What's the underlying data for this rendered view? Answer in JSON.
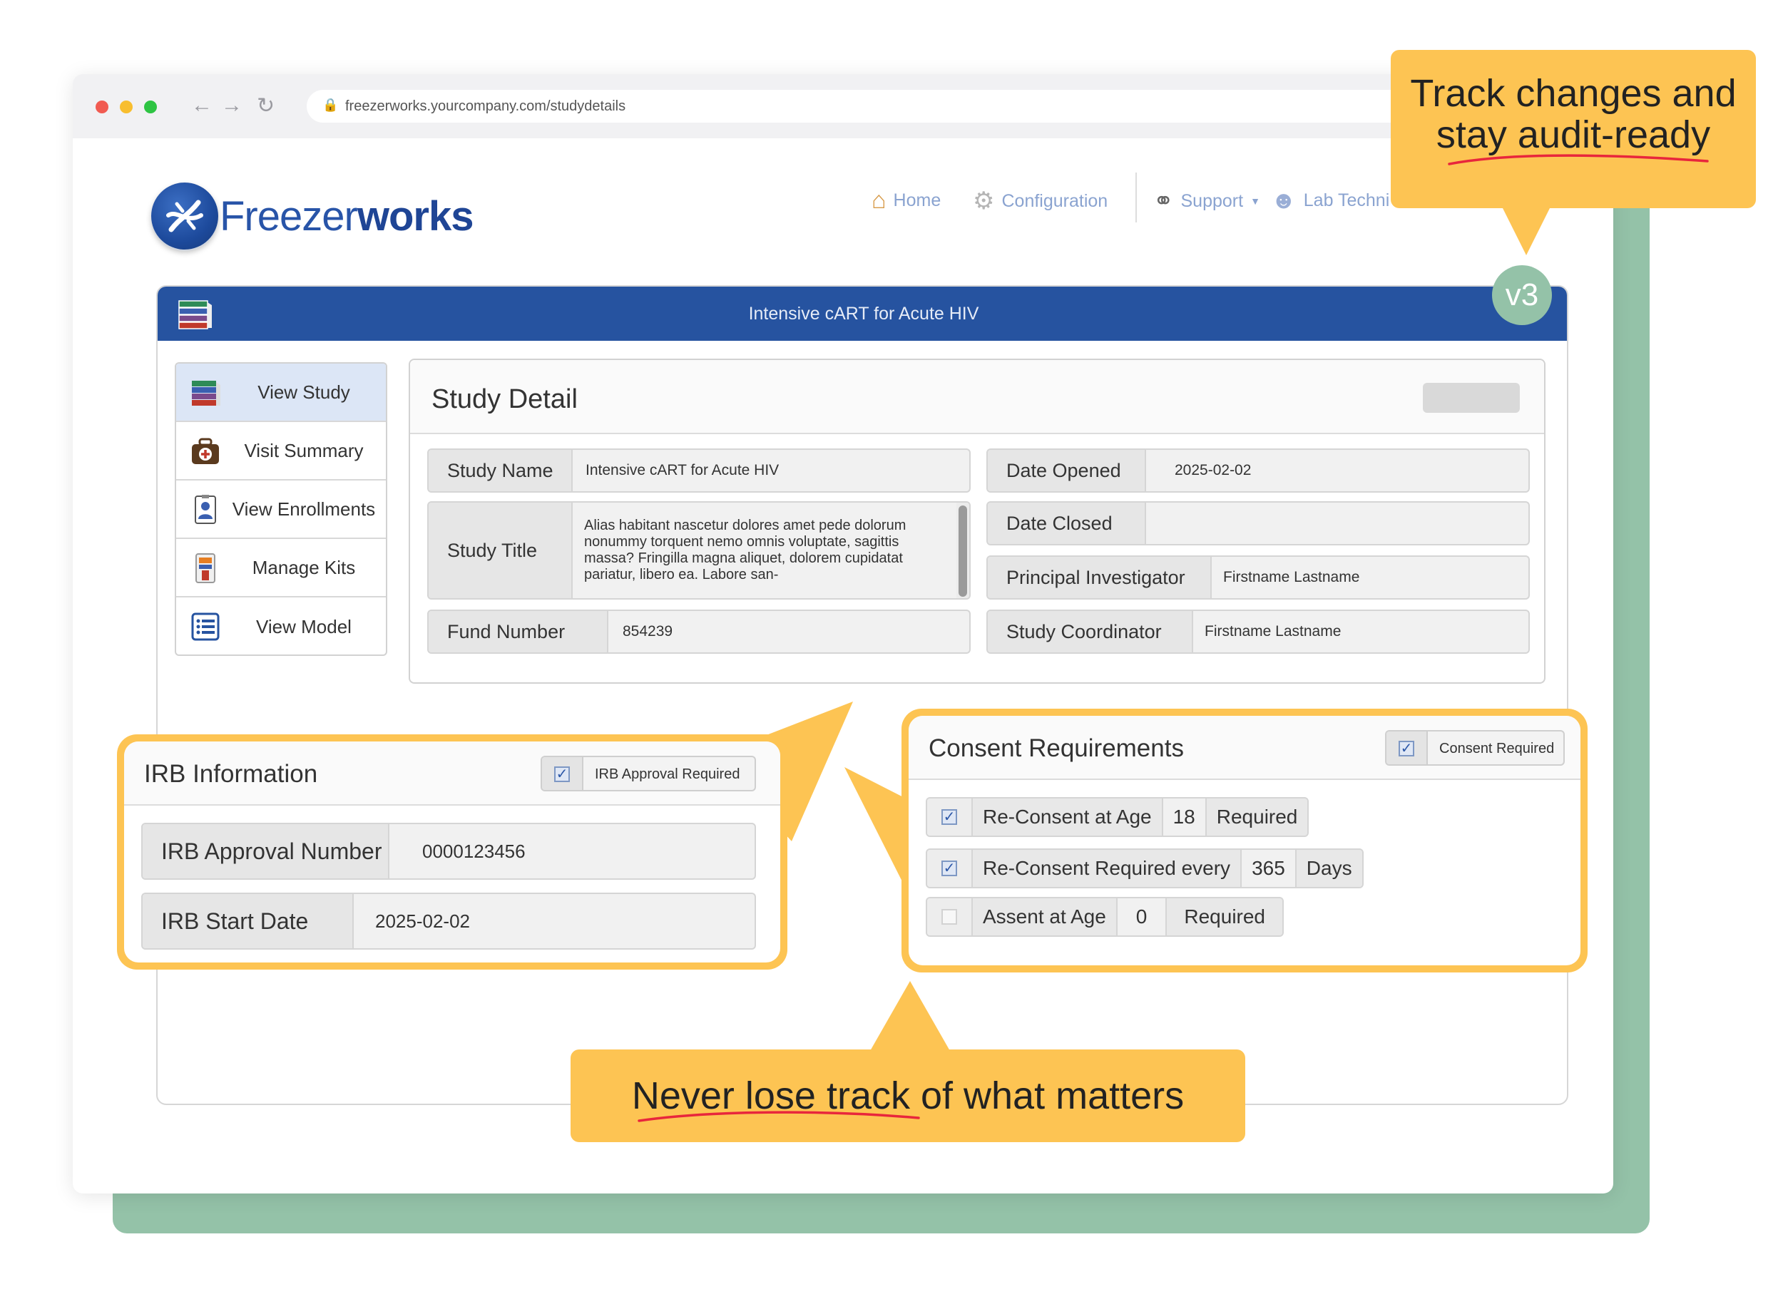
{
  "browser": {
    "url": "freezerworks.yourcompany.com/studydetails",
    "traffic_colors": [
      "#f15b51",
      "#f8be2e",
      "#2ec443"
    ]
  },
  "app": {
    "logo_prefix": "Freezer",
    "logo_suffix": "works",
    "brand_color": "#2653a0"
  },
  "topnav": {
    "home": "Home",
    "configuration": "Configuration",
    "support": "Support",
    "user": "Lab Techni"
  },
  "header": {
    "title": "Intensive cART for Acute HIV",
    "version": "v3"
  },
  "sidebar": {
    "items": [
      {
        "label": "View Study",
        "icon": "books-icon",
        "active": true
      },
      {
        "label": "Visit Summary",
        "icon": "medical-bag-icon",
        "active": false
      },
      {
        "label": "View Enrollments",
        "icon": "id-badge-icon",
        "active": false
      },
      {
        "label": "Manage Kits",
        "icon": "kit-icon",
        "active": false
      },
      {
        "label": "View Model",
        "icon": "list-icon",
        "active": false
      }
    ]
  },
  "study_detail": {
    "title": "Study Detail",
    "study_name_label": "Study Name",
    "study_name": "Intensive cART for Acute HIV",
    "study_title_label": "Study Title",
    "study_title": "Alias habitant nascetur dolores amet pede dolorum nonummy torquent nemo omnis voluptate, sagittis massa? Fringilla magna aliquet, dolorem cupidatat pariatur, libero ea. Labore san-",
    "fund_number_label": "Fund Number",
    "fund_number": "854239",
    "date_opened_label": "Date Opened",
    "date_opened": "2025-02-02",
    "date_closed_label": "Date Closed",
    "date_closed": "",
    "pi_label": "Principal Investigator",
    "pi": "Firstname Lastname",
    "coordinator_label": "Study Coordinator",
    "coordinator": "Firstname Lastname"
  },
  "irb": {
    "title": "IRB Information",
    "approval_required_label": "IRB Approval Required",
    "approval_required": true,
    "approval_number_label": "IRB Approval Number",
    "approval_number": "0000123456",
    "start_date_label": "IRB Start Date",
    "start_date": "2025-02-02"
  },
  "consent": {
    "title": "Consent Requirements",
    "consent_required_label": "Consent Required",
    "consent_required": true,
    "reconsent_age_label": "Re-Consent at Age",
    "reconsent_age": "18",
    "reconsent_age_suffix": "Required",
    "reconsent_age_checked": true,
    "reconsent_every_label": "Re-Consent Required every",
    "reconsent_every": "365",
    "reconsent_every_suffix": "Days",
    "reconsent_every_checked": true,
    "assent_label": "Assent at Age",
    "assent_age": "0",
    "assent_suffix": "Required",
    "assent_checked": false
  },
  "callouts": {
    "top_line1": "Track changes and",
    "top_line2": "stay audit-ready",
    "bottom": "Never lose track of what matters",
    "color": "#fdc453",
    "underline_color": "#e8263c"
  }
}
